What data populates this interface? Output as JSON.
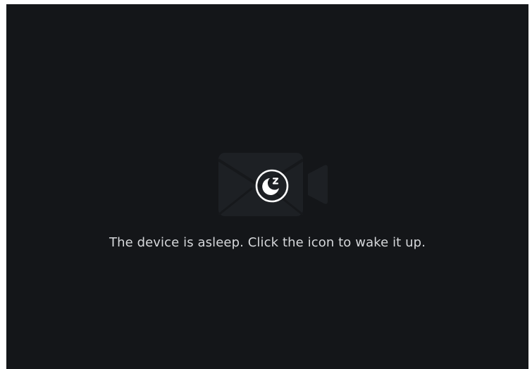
{
  "viewer": {
    "background_color": "#141619",
    "placeholder_icon": "video-camera-icon",
    "wake_icon": "sleep-moon-icon",
    "message": "The device is asleep. Click the icon to wake it up."
  },
  "colors": {
    "text": "#d6d8db",
    "icon": "#ffffff",
    "camera_silhouette": "#1d2024"
  }
}
